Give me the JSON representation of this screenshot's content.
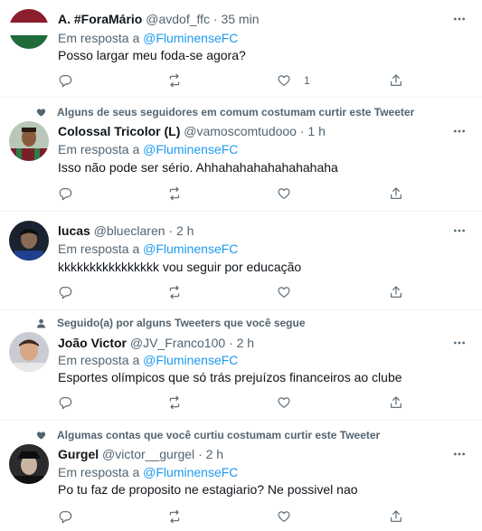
{
  "tweets": [
    {
      "social_context": "",
      "name": "A. #ForaMário",
      "handle": "@avdof_ffc",
      "time": "· 35 min",
      "reply_prefix": "Em resposta a",
      "reply_to": "@FluminenseFC",
      "text": "Posso largar meu foda-se agora?",
      "like_count": "1"
    },
    {
      "social_context": "Alguns de seus seguidores em comum costumam curtir este Tweeter",
      "name": "Colossal Tricolor (L)",
      "handle": "@vamoscomtudooo",
      "time": "· 1 h",
      "reply_prefix": "Em resposta a",
      "reply_to": "@FluminenseFC",
      "text": "Isso não pode ser sério. Ahhahahahahahahahaha",
      "like_count": ""
    },
    {
      "social_context": "",
      "name": "lucas",
      "handle": "@blueclaren",
      "time": "· 2 h",
      "reply_prefix": "Em resposta a",
      "reply_to": "@FluminenseFC",
      "text": "kkkkkkkkkkkkkkkk vou seguir por educação",
      "like_count": ""
    },
    {
      "social_context": "Seguido(a) por alguns Tweeters que você segue",
      "name": "João Victor",
      "handle": "@JV_Franco100",
      "time": "· 2 h",
      "reply_prefix": "Em resposta a",
      "reply_to": "@FluminenseFC",
      "text": "Esportes olímpicos que só trás prejuízos financeiros ao clube",
      "like_count": ""
    },
    {
      "social_context": "Algumas contas que você curtiu costumam curtir este Tweeter",
      "name": "Gurgel",
      "handle": "@victor__gurgel",
      "time": "· 2 h",
      "reply_prefix": "Em resposta a",
      "reply_to": "@FluminenseFC",
      "text": "Po tu faz de proposito ne estagiario? Ne possivel nao",
      "like_count": ""
    }
  ],
  "icons": {
    "social_heart": "heart-icon",
    "social_person": "person-icon",
    "more": "more-dots-icon",
    "reply": "reply-icon",
    "retweet": "retweet-icon",
    "like": "like-icon",
    "share": "share-icon"
  },
  "colors": {
    "link": "#1d9bf0",
    "secondary_text": "#536471",
    "divider": "#eff3f4"
  }
}
